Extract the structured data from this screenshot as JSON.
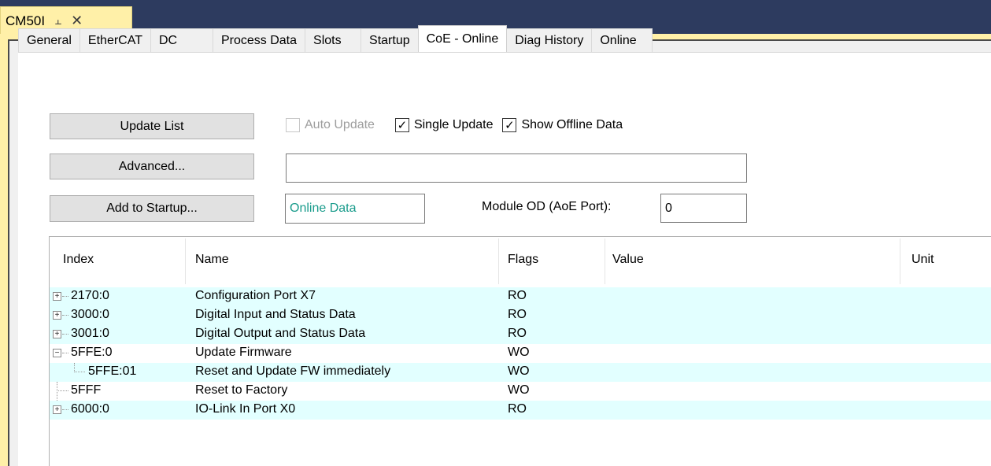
{
  "doc_tab": {
    "title": "CM50I",
    "pin_icon": "pin-icon",
    "close_icon": "close-icon"
  },
  "tabs": [
    {
      "label": "General"
    },
    {
      "label": "EtherCAT"
    },
    {
      "label": "DC"
    },
    {
      "label": "Process Data"
    },
    {
      "label": "Slots"
    },
    {
      "label": "Startup"
    },
    {
      "label": "CoE - Online",
      "active": true
    },
    {
      "label": "Diag History"
    },
    {
      "label": "Online"
    }
  ],
  "buttons": {
    "update_list": "Update List",
    "advanced": "Advanced...",
    "add_to_startup": "Add to Startup..."
  },
  "checkboxes": {
    "auto_update": {
      "label": "Auto Update",
      "checked": false,
      "enabled": false
    },
    "single_update": {
      "label": "Single Update",
      "checked": true
    },
    "show_offline": {
      "label": "Show Offline Data",
      "checked": true
    }
  },
  "search_field": {
    "value": ""
  },
  "online_data": {
    "value": "Online Data",
    "color": "#1a9c8c"
  },
  "module_od": {
    "label": "Module OD (AoE Port):",
    "value": "0"
  },
  "list": {
    "columns": [
      "Index",
      "Name",
      "Flags",
      "Value",
      "Unit"
    ],
    "rows": [
      {
        "index": "2170:0",
        "name": "Configuration Port X7",
        "flags": "RO",
        "value": "",
        "unit": "",
        "expander": "+",
        "level": 0,
        "highlight": true
      },
      {
        "index": "3000:0",
        "name": "Digital Input and Status Data",
        "flags": "RO",
        "value": "",
        "unit": "",
        "expander": "+",
        "level": 0,
        "highlight": true
      },
      {
        "index": "3001:0",
        "name": "Digital Output and Status Data",
        "flags": "RO",
        "value": "",
        "unit": "",
        "expander": "+",
        "level": 0,
        "highlight": true
      },
      {
        "index": "5FFE:0",
        "name": "Update Firmware",
        "flags": "WO",
        "value": "",
        "unit": "",
        "expander": "-",
        "level": 0,
        "highlight": false
      },
      {
        "index": "5FFE:01",
        "name": "Reset and Update FW immediately",
        "flags": "WO",
        "value": "",
        "unit": "",
        "expander": "",
        "level": 1,
        "highlight": true
      },
      {
        "index": "5FFF",
        "name": "Reset to Factory",
        "flags": "WO",
        "value": "",
        "unit": "",
        "expander": "",
        "level": 0,
        "highlight": false
      },
      {
        "index": "6000:0",
        "name": "IO-Link In Port X0",
        "flags": "RO",
        "value": "",
        "unit": "",
        "expander": "+",
        "level": 0,
        "highlight": true
      }
    ]
  },
  "colors": {
    "row_highlight": "#e2ffff",
    "doc_tab": "#fff0a8",
    "background": "#2d3b5f"
  }
}
